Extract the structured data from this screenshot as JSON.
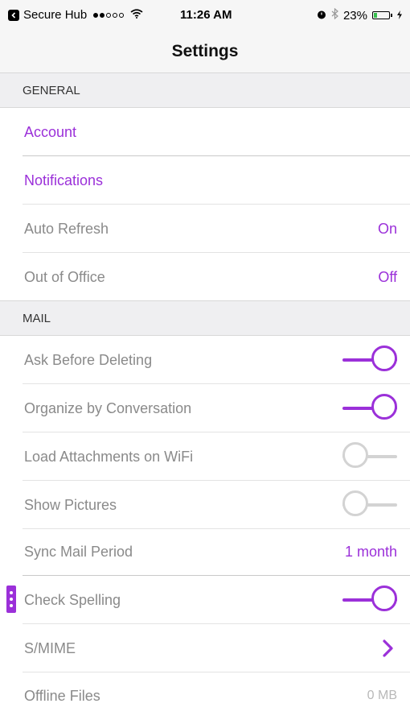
{
  "status_bar": {
    "carrier": "Secure Hub",
    "time": "11:26 AM",
    "battery": "23%",
    "battery_level": 0.23,
    "signal_bars_filled": 2,
    "signal_bars_total": 5
  },
  "nav": {
    "title": "Settings"
  },
  "accent_color": "#9b30d9",
  "sections": {
    "general": {
      "header": "GENERAL",
      "account": "Account",
      "notifications": "Notifications",
      "auto_refresh": {
        "label": "Auto Refresh",
        "value": "On"
      },
      "out_of_office": {
        "label": "Out of Office",
        "value": "Off"
      }
    },
    "mail": {
      "header": "MAIL",
      "ask_before_deleting": {
        "label": "Ask Before Deleting",
        "on": true
      },
      "organize_by_conversation": {
        "label": "Organize by Conversation",
        "on": true
      },
      "load_attachments_wifi": {
        "label": "Load Attachments on WiFi",
        "on": false
      },
      "show_pictures": {
        "label": "Show Pictures",
        "on": false
      },
      "sync_mail_period": {
        "label": "Sync Mail Period",
        "value": "1 month"
      },
      "check_spelling": {
        "label": "Check Spelling",
        "on": true
      },
      "smime": {
        "label": "S/MIME"
      },
      "offline_files": {
        "label": "Offline Files",
        "value": "0 MB"
      }
    }
  },
  "icons": [
    "back-to-app-icon",
    "signal-icon",
    "wifi-icon",
    "alarm-icon",
    "bluetooth-icon",
    "battery-icon",
    "charging-icon",
    "chevron-right-icon",
    "drag-handle-icon"
  ]
}
